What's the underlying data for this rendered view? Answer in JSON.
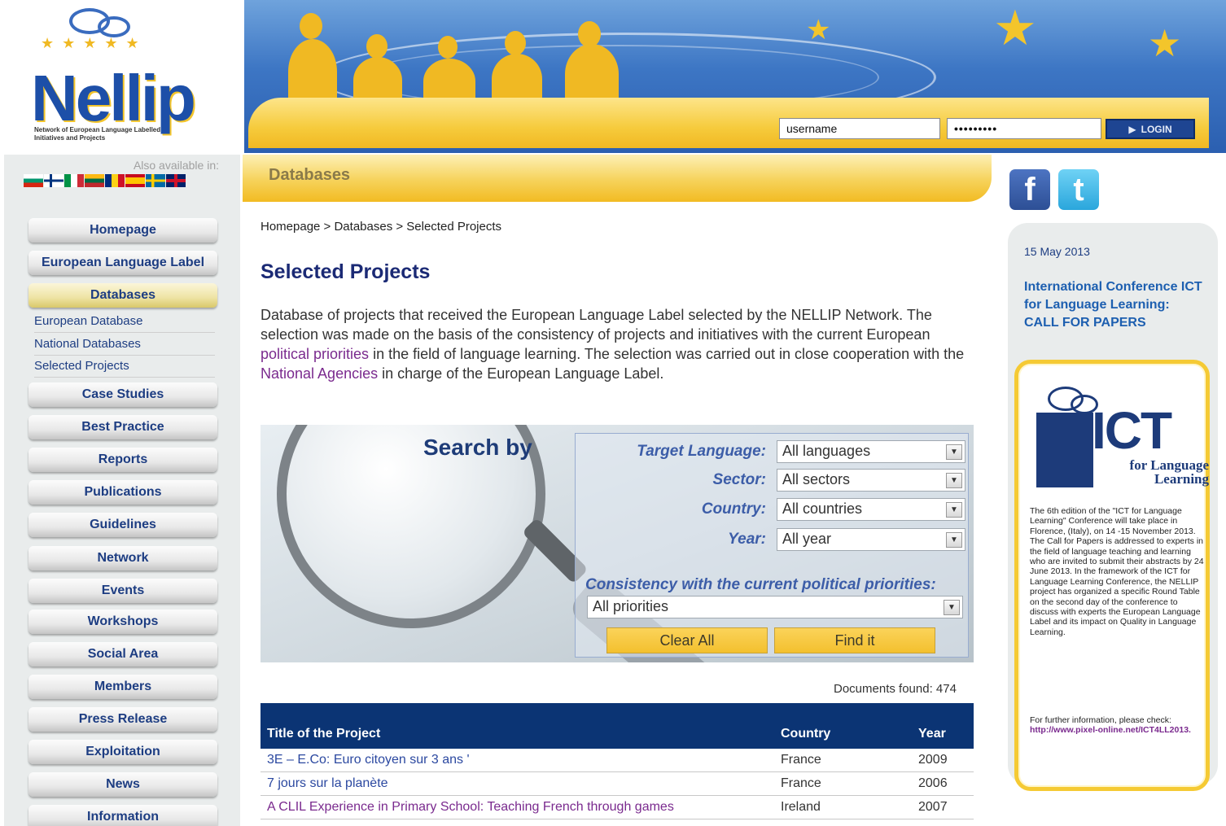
{
  "login": {
    "username_value": "username",
    "password_value": "•••••••••",
    "button_label": "LOGIN"
  },
  "logo": {
    "name": "Nellip",
    "tagline": "Network of European Language Labelled Initiatives and Projects"
  },
  "languages": {
    "label": "Also available in:",
    "flags": [
      "bulgarian-flag",
      "finnish-flag",
      "italian-flag",
      "lithuanian-flag",
      "romanian-flag",
      "spanish-flag",
      "swedish-flag",
      "uk-flag"
    ]
  },
  "nav": {
    "items": [
      {
        "label": "Homepage"
      },
      {
        "label": "European Language Label"
      },
      {
        "label": "Databases",
        "active": true
      },
      {
        "label": "Case Studies"
      },
      {
        "label": "Best Practice"
      },
      {
        "label": "Reports"
      },
      {
        "label": "Publications"
      },
      {
        "label": "Guidelines"
      },
      {
        "label": "Network"
      },
      {
        "label": "Events"
      },
      {
        "label": "Workshops"
      },
      {
        "label": "Social Area"
      },
      {
        "label": "Members"
      },
      {
        "label": "Press Release"
      },
      {
        "label": "Exploitation"
      },
      {
        "label": "News"
      },
      {
        "label": "Information"
      }
    ],
    "subitems": [
      {
        "label": "European Database"
      },
      {
        "label": "National Databases"
      },
      {
        "label": "Selected Projects"
      }
    ]
  },
  "section": {
    "title": "Databases"
  },
  "breadcrumb": "Homepage > Databases > Selected Projects",
  "page_title": "Selected Projects",
  "intro": {
    "part1": "Database of projects that received the European Language Label selected by the NELLIP Network. The selection was made on the basis of the consistency of projects and initiatives with the current European ",
    "link1": "political priorities",
    "part2": " in the field of language learning. The selection was carried out in close cooperation with the ",
    "link2": "National Agencies",
    "part3": " in charge of the European Language Label."
  },
  "search": {
    "heading": "Search by",
    "target_language": {
      "label": "Target Language:",
      "value": "All languages"
    },
    "sector": {
      "label": "Sector:",
      "value": "All sectors"
    },
    "country": {
      "label": "Country:",
      "value": "All countries"
    },
    "year": {
      "label": "Year:",
      "value": "All year"
    },
    "consistency": {
      "label": "Consistency with the current political priorities:",
      "value": "All priorities"
    },
    "clear_label": "Clear All",
    "find_label": "Find it"
  },
  "results": {
    "documents_found": "Documents found: 474",
    "columns": {
      "title": "Title of the Project",
      "country": "Country",
      "year": "Year"
    },
    "rows": [
      {
        "title": "3E – E.Co: Euro citoyen sur 3 ans '",
        "country": "France",
        "year": "2009",
        "visited": false
      },
      {
        "title": "7 jours sur la planète",
        "country": "France",
        "year": "2006",
        "visited": false
      },
      {
        "title": "A CLIL Experience in Primary School: Teaching French through games",
        "country": "Ireland",
        "year": "2007",
        "visited": true
      }
    ]
  },
  "social": {
    "facebook_glyph": "f",
    "twitter_glyph": "t"
  },
  "news": {
    "date": "15 May 2013",
    "headline": "International Conference ICT for Language Learning: CALL FOR PAPERS",
    "ict_logo_big": "ICT",
    "ict_logo_small": "for Language Learning",
    "body": "The 6th edition of the \"ICT for Language Learning\" Conference will take place in Florence, (Italy), on 14 -15 November 2013. The Call for Papers is addressed to experts in the field of language teaching and learning who are invited to submit their abstracts by 24 June 2013. In the framework of the ICT for Language Learning Conference, the NELLIP project has organized a specific Round Table on the second day of the conference to discuss with experts the European Language Label and its impact on Quality in Language Learning.",
    "further_text": "For further information, please check: ",
    "further_url": "http://www.pixel-online.net/ICT4LL2013."
  }
}
